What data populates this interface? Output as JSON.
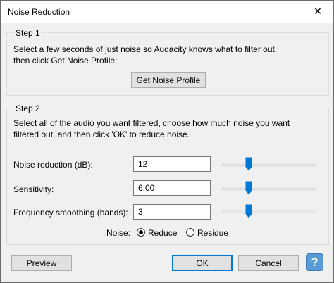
{
  "window": {
    "title": "Noise Reduction",
    "close_glyph": "✕"
  },
  "step1": {
    "label": "Step 1",
    "line1": "Select a few seconds of just noise so Audacity knows what to filter out,",
    "line2": "then click Get Noise Profile:",
    "button": "Get Noise Profile"
  },
  "step2": {
    "label": "Step 2",
    "line1": "Select all of the audio you want filtered, choose how much noise you want",
    "line2": "filtered out, and then click 'OK' to reduce noise.",
    "params": [
      {
        "label": "Noise reduction (dB):",
        "value": "12",
        "slider_fraction": 0.27
      },
      {
        "label": "Sensitivity:",
        "value": "6.00",
        "slider_fraction": 0.27
      },
      {
        "label": "Frequency smoothing (bands):",
        "value": "3",
        "slider_fraction": 0.27
      }
    ],
    "noise_label": "Noise:",
    "options": [
      {
        "label": "Reduce",
        "selected": true
      },
      {
        "label": "Residue",
        "selected": false
      }
    ]
  },
  "buttons": {
    "preview": "Preview",
    "ok": "OK",
    "cancel": "Cancel",
    "help": "?"
  },
  "colors": {
    "slider_thumb": "#0078d7",
    "help_button": "#5b9bd5"
  },
  "icons": {
    "close": "close-icon",
    "help": "help-icon"
  }
}
